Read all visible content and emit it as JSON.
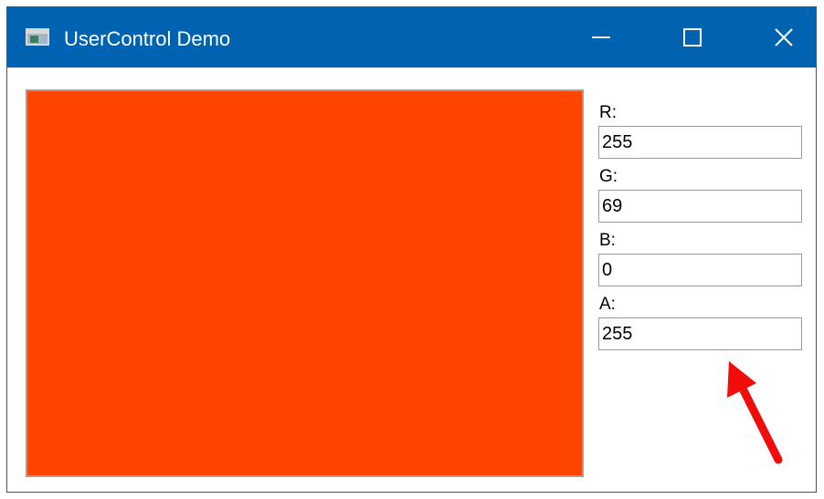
{
  "window": {
    "title": "UserControl Demo",
    "icon": "app-window-icon",
    "controls": [
      "minimize-icon",
      "maximize-icon",
      "close-icon"
    ]
  },
  "colors": {
    "titlebar": "#0063b1",
    "swatch": "#ff4500",
    "arrow": "#f20c0c"
  },
  "color_preview": {
    "fill": "#ff4500"
  },
  "fields": {
    "r": {
      "label": "R:",
      "value": "255"
    },
    "g": {
      "label": "G:",
      "value": "69"
    },
    "b": {
      "label": "B:",
      "value": "0"
    },
    "a": {
      "label": "A:",
      "value": "255"
    }
  }
}
